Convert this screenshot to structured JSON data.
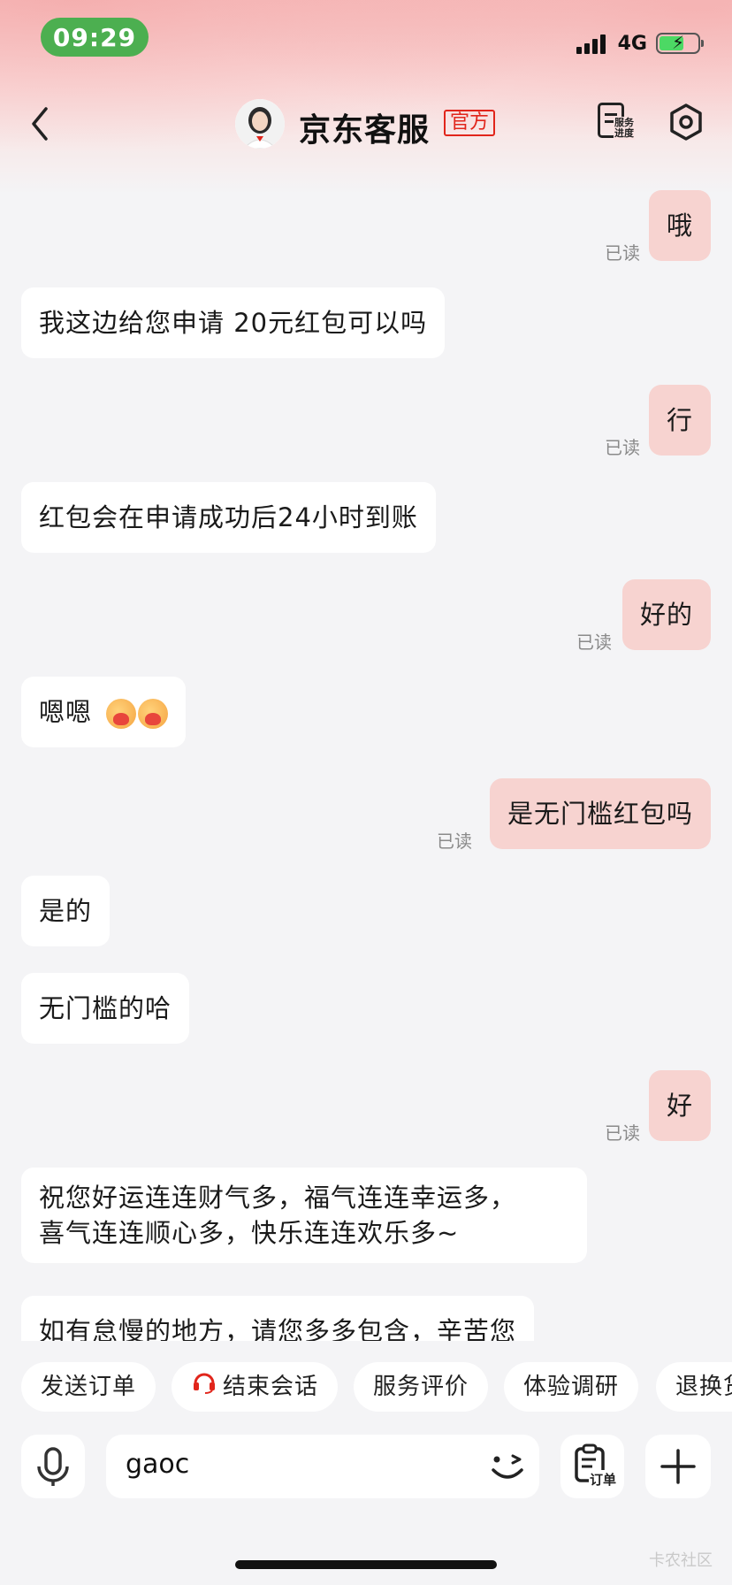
{
  "status_bar": {
    "time": "09:29",
    "network": "4G"
  },
  "header": {
    "title": "京东客服",
    "badge": "官方",
    "progress_label_1": "服务",
    "progress_label_2": "进度"
  },
  "messages": {
    "m1": "哦",
    "m1_read": "已读",
    "m2": "我这边给您申请 20元红包可以吗",
    "m3": "行",
    "m3_read": "已读",
    "m4": "红包会在申请成功后24小时到账",
    "m5": "好的",
    "m5_read": "已读",
    "m6": "嗯嗯",
    "m7": "是无门槛红包吗",
    "m7_read": "已读",
    "m8": "是的",
    "m9": "无门槛的哈",
    "m10": "好",
    "m10_read": "已读",
    "m11_line1": "祝您好运连连财气多，福气连连幸运多，",
    "m11_line2": "喜气连连顺心多，快乐连连欢乐多~",
    "m12": "如有怠慢的地方，请您多多包含，辛苦您"
  },
  "quick_actions": [
    "发送订单",
    "结束会话",
    "服务评价",
    "体验调研",
    "退换货"
  ],
  "input": {
    "value": "gaoc",
    "order_label": "订单"
  },
  "watermark": "卡农社区"
}
